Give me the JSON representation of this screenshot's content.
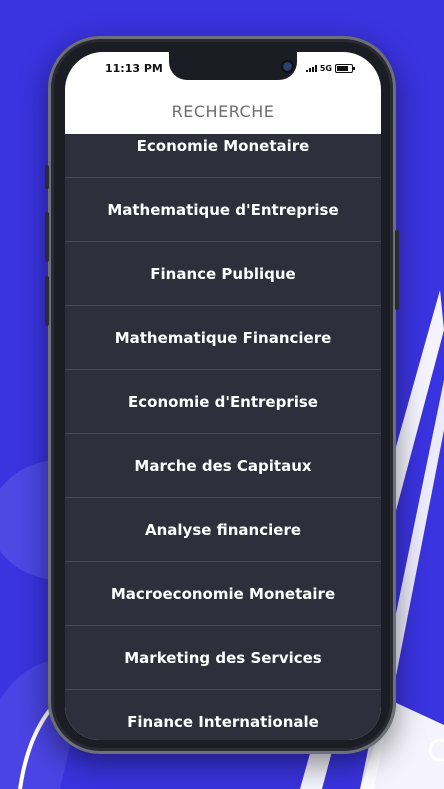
{
  "status_bar": {
    "time": "11:13 PM",
    "network": "5G"
  },
  "header": {
    "title": "RECHERCHE"
  },
  "list": {
    "items": [
      "Economie Monetaire",
      "Mathematique d'Entreprise",
      "Finance Publique",
      "Mathematique Financiere",
      "Economie d'Entreprise",
      "Marche des Capitaux",
      "Analyse financiere",
      "Macroeconomie Monetaire",
      "Marketing des Services",
      "Finance Internationale"
    ]
  },
  "colors": {
    "background": "#3a33e0",
    "list_background": "#2f2f3b",
    "separator": "#4a4470",
    "header_text": "#6e6e6e"
  }
}
